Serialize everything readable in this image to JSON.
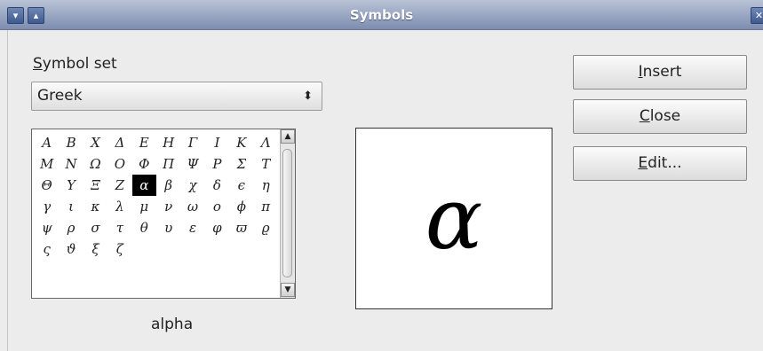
{
  "window": {
    "title": "Symbols",
    "menu_button_glyph": "▾",
    "shade_button_glyph": "▴",
    "close_button_glyph": "✕"
  },
  "symbol_set": {
    "label": "Symbol set",
    "value": "Greek",
    "arrow_glyph": "⬍"
  },
  "symbols": {
    "rows": [
      [
        "Α",
        "Β",
        "Χ",
        "Δ",
        "Ε",
        "Η",
        "Γ",
        "Ι",
        "Κ",
        "Λ"
      ],
      [
        "Μ",
        "Ν",
        "Ω",
        "Ο",
        "Φ",
        "Π",
        "Ψ",
        "Ρ",
        "Σ",
        "Τ"
      ],
      [
        "Θ",
        "Υ",
        "Ξ",
        "Ζ",
        "α",
        "β",
        "χ",
        "δ",
        "ϵ",
        "η"
      ],
      [
        "γ",
        "ι",
        "κ",
        "λ",
        "μ",
        "ν",
        "ω",
        "ο",
        "ϕ",
        "π"
      ],
      [
        "ψ",
        "ρ",
        "σ",
        "τ",
        "θ",
        "υ",
        "ε",
        "φ",
        "ϖ",
        "ϱ"
      ],
      [
        "ς",
        "ϑ",
        "ξ",
        "ζ"
      ]
    ],
    "selected": "α",
    "selected_name": "alpha",
    "scroll_up_glyph": "▲",
    "scroll_down_glyph": "▼"
  },
  "preview": {
    "char": "α"
  },
  "buttons": {
    "insert": "Insert",
    "close": "Close",
    "edit": "Edit..."
  }
}
